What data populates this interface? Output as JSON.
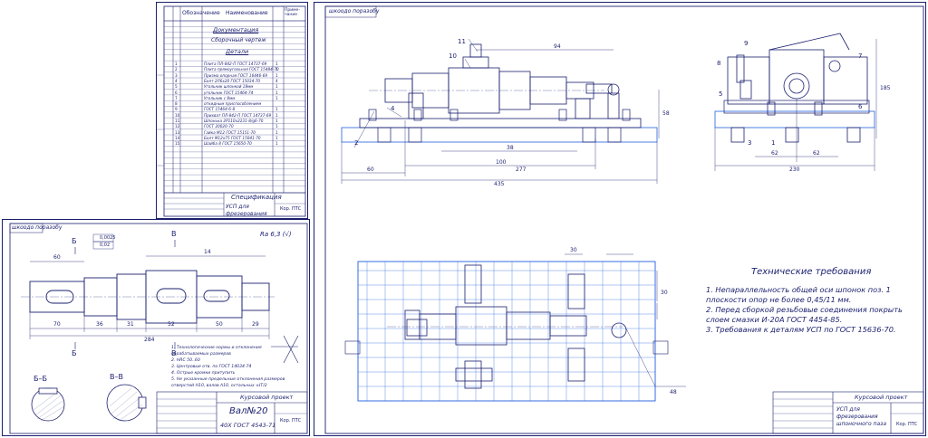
{
  "spec": {
    "headers": [
      "Обозначение",
      "Наименование",
      "Приме-чание"
    ],
    "sections": [
      "Документация",
      "Сборочный чертеж",
      "Детали"
    ],
    "rows": [
      {
        "pos": "1",
        "name": "Плита ПЛ-842-П ГОСТ 14737-69",
        "qty": "1"
      },
      {
        "pos": "2",
        "name": "Плита прямоугольная ГОСТ 15484-70",
        "qty": "1"
      },
      {
        "pos": "3",
        "name": "Призма опорная ГОСТ 16446-69",
        "qty": "1"
      },
      {
        "pos": "4",
        "name": "Болт 2Л6x20 ГОСТ 15034-70",
        "qty": "4"
      },
      {
        "pos": "5",
        "name": "Угольник шпонкой 18мм",
        "qty": "1"
      },
      {
        "pos": "6",
        "name": "угольник ГОСТ 15464-74",
        "qty": "1"
      },
      {
        "pos": "7",
        "name": "Угольник с 8мм",
        "qty": "1"
      },
      {
        "pos": "8",
        "name": "откидным приспособлением",
        "qty": ""
      },
      {
        "pos": "9",
        "name": "ГОСТ 15464-6-8",
        "qty": "1"
      },
      {
        "pos": "10",
        "name": "Прихват ПЛ-842-П ГОСТ 14737-69",
        "qty": "1"
      },
      {
        "pos": "11",
        "name": "Шпонька 2Р110x2231-8/g6-70",
        "qty": "1"
      },
      {
        "pos": "12",
        "name": "ГОСТ 20020-70",
        "qty": "1"
      },
      {
        "pos": "13",
        "name": "Гайка M12 ГОСТ 15151-70",
        "qty": "1"
      },
      {
        "pos": "14",
        "name": "Болт M12x75 ГОСТ 15041-70",
        "qty": "1"
      },
      {
        "pos": "15",
        "name": "Шайба 8 ГОСТ 15650-70",
        "qty": "1"
      }
    ],
    "title_label": "Спецификация",
    "title_name": "УСП для фрезерования шпоночного паза",
    "sheet_label": "Кор. ПТС"
  },
  "shaft": {
    "tag": "шкоодо поразобу",
    "roughness": "Ra 6,3 (√)",
    "tolerances": [
      "0,0025",
      "0,02"
    ],
    "section_letters": [
      "Б",
      "Б",
      "В",
      "В"
    ],
    "label_b": "Б–Б",
    "label_v": "В–В",
    "dims": [
      "70",
      "36",
      "31",
      "52",
      "50",
      "29",
      "284",
      "14",
      "60"
    ],
    "notes": [
      "1. Технологические нормы и отклонения",
      "обрабатываемых размеров",
      "2. HRC 50..60",
      "3. Центровые отв. по ГОСТ 14034-74",
      "4. Острые кромки притупить",
      "5. Не указанные предельные отклонения размеров",
      "отверстий H10, валов h10, остальных ±IT/2"
    ],
    "title_course": "Курсовой проект",
    "part_name": "Вал№20",
    "material": "40Х ГОСТ 4543-71",
    "sheet_label": "Кор. ПТС"
  },
  "assembly": {
    "tag": "шкоодо поразобу",
    "tech_title": "Технические требования",
    "tech_items": [
      "1. Непараллельность общей оси шпонок поз. 1",
      "плоскости опор не более 0,45/11 мм.",
      "2. Перед сборкой резьбовые соединения покрыть",
      "слоем смазки И-20А ГОСТ 4454-85.",
      "3. Требования к деталям УСП по ГОСТ 15636-70."
    ],
    "dims": [
      "60",
      "277",
      "435",
      "100",
      "38",
      "94",
      "58",
      "230",
      "62",
      "62",
      "185",
      "30",
      "30",
      "48"
    ],
    "callouts": [
      "1",
      "2",
      "3",
      "4",
      "5",
      "6",
      "7",
      "8",
      "9",
      "10",
      "11"
    ],
    "title_course": "Курсовой проект",
    "title_name": "УСП для фрезерования шпоночного паза",
    "sheet_label": "Кор. ПТС"
  }
}
